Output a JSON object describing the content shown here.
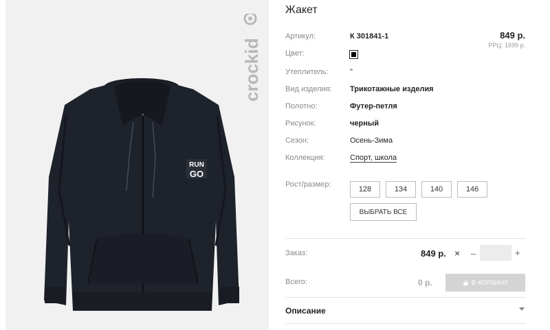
{
  "brand": {
    "logo_text": "crockid"
  },
  "product": {
    "title": "Жакет",
    "print_text_line1": "RUN",
    "print_text_line2": "GO"
  },
  "price": {
    "value": "849 р.",
    "rrp": "РРЦ: 1699 р."
  },
  "attributes": [
    {
      "label": "Артикул:",
      "value": "К 301841-1"
    },
    {
      "label": "Цвет:",
      "value": ""
    },
    {
      "label": "Утеплитель:",
      "value": "\""
    },
    {
      "label": "Вид изделия:",
      "value": "Трикотажные изделия"
    },
    {
      "label": "Полотно:",
      "value": "Футер-петля"
    },
    {
      "label": "Рисунок:",
      "value": "черный"
    },
    {
      "label": "Сезон:",
      "value": "Осень-Зима"
    },
    {
      "label": "Коллекция:",
      "value": "Спорт, школа"
    }
  ],
  "color_swatch": {
    "color": "#000000"
  },
  "sizes": {
    "label": "Рост/размер:",
    "options": [
      "128",
      "134",
      "140",
      "146"
    ],
    "select_all": "ВЫБРАТЬ ВСЕ"
  },
  "order": {
    "label": "Заказ:",
    "price": "849 р.",
    "times": "×",
    "minus": "–",
    "plus": "+",
    "quantity": ""
  },
  "total": {
    "label": "Всего:",
    "value": "0 р."
  },
  "cart_button": {
    "label": "В КОРЗИНУ"
  },
  "description": {
    "label": "Описание"
  }
}
